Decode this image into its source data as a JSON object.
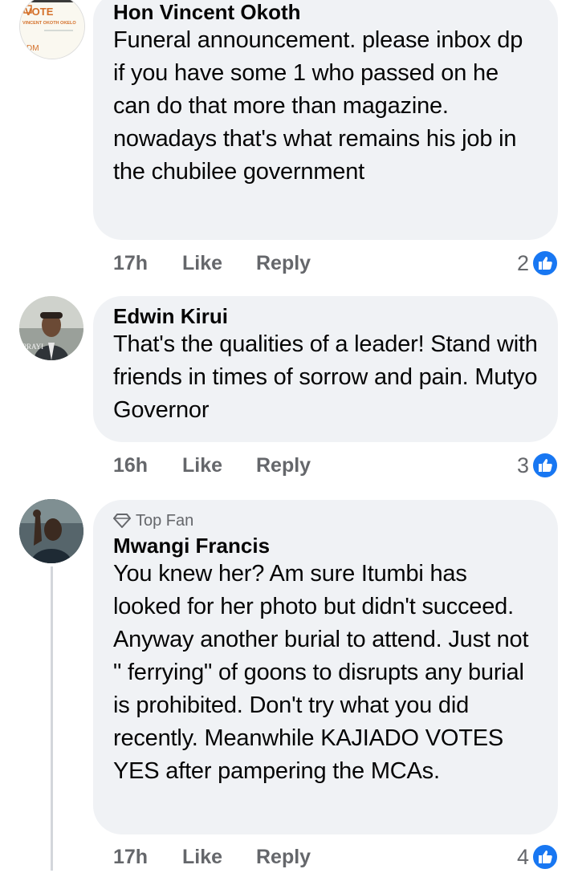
{
  "comments": [
    {
      "author": "Hon Vincent Okoth",
      "badge": "",
      "text": "Funeral announcement. please inbox dp if you have some 1 who passed on he can do that more than magazine. nowadays that's what remains his job in the chubilee government",
      "time": "17h",
      "like_label": "Like",
      "reply_label": "Reply",
      "reactions": "2",
      "avatar_text": {
        "line1": "VOTE",
        "line2": "VINCENT OKOTH OKELO",
        "line3": "DM"
      }
    },
    {
      "author": "Edwin Kirui",
      "badge": "",
      "text": "That's the qualities of a leader! Stand with friends in times of sorrow and pain. Mutyo Governor",
      "time": "16h",
      "like_label": "Like",
      "reply_label": "Reply",
      "reactions": "3"
    },
    {
      "author": "Mwangi Francis",
      "badge": "Top Fan",
      "text": "You knew her? Am sure Itumbi has looked for her photo but didn't succeed.  Anyway another burial to attend. Just not \" ferrying\" of goons to disrupts any burial is prohibited. Don't try what you did recently. Meanwhile KAJIADO VOTES YES after pampering the MCAs.",
      "time": "17h",
      "like_label": "Like",
      "reply_label": "Reply",
      "reactions": "4"
    }
  ],
  "colors": {
    "bubble": "#f0f2f5",
    "meta_text": "#65676b",
    "like_blue": "#1877f2"
  }
}
